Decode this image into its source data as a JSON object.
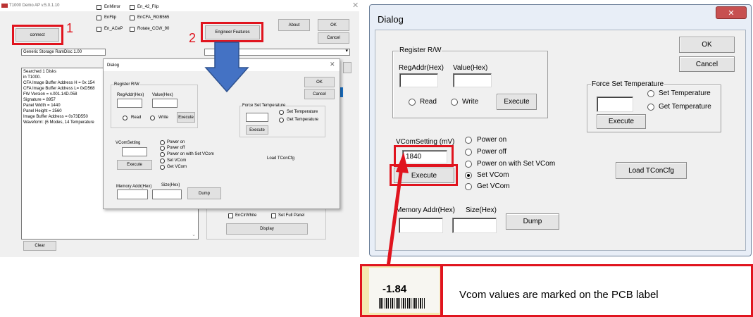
{
  "left_app": {
    "title": "T1000 Demo AP v.5.0.1.10",
    "connect_label": "connect",
    "step1": "1",
    "step2": "2",
    "checkboxes": [
      "EnMirror",
      "En_42_Flip",
      "EnFlip",
      "EnCFA_RGB565",
      "En_ACeP",
      "Rotate_CCW_90"
    ],
    "engineer_label": "Engineer Features",
    "about_label": "About",
    "ok_label": "OK",
    "cancel_label": "Cancel",
    "disk_select": "Generic Storage RamDisc 1.00",
    "log_lines": [
      "Searched 1 Disks",
      "in T1000.",
      "CFA Image Buffer Address H = 0x 154",
      "CFA Image Buffer Address L= 0xD568",
      "FW Version = v.001.14D.058",
      "Signature = 8957",
      "Panel Width = 1440",
      "Panel Height = 2560",
      "Image Buffer Address = 0x73D550",
      "Waveform: (6 Modes, 14 Temperature"
    ],
    "en_clr_white": "EnClrWhite",
    "set_full_panel": "Set Full Panel",
    "display_label": "Display",
    "clear_label": "Clear"
  },
  "dialog": {
    "title": "Dialog",
    "close": "✕",
    "register_group": "Register R/W",
    "reg_addr": "RegAddr(Hex)",
    "value": "Value(Hex)",
    "read": "Read",
    "write": "Write",
    "execute": "Execute",
    "ok": "OK",
    "cancel": "Cancel",
    "force_temp_group": "Force Set Temperature",
    "set_temp": "Set Temperature",
    "get_temp": "Get Temperature",
    "vcom_setting_small": "VComSetting",
    "vcom_setting": "VComSetting (mV)",
    "vcom_value": "1840",
    "power_on": "Power on",
    "power_off": "Power off",
    "power_on_set_vcom": "Power on with Set VCom",
    "set_vcom": "Set VCom",
    "get_vcom": "Get VCom",
    "load_tcon": "Load TConCfg",
    "memory_addr": "Memory Addr(Hex)",
    "size": "Size(Hex)",
    "dump": "Dump"
  },
  "callout": {
    "pcb_value": "-1.84",
    "note": "Vcom values are marked on the PCB label"
  },
  "colors": {
    "highlight_red": "#e0141e",
    "arrow_blue": "#4472c4",
    "close_red": "#c75050"
  }
}
